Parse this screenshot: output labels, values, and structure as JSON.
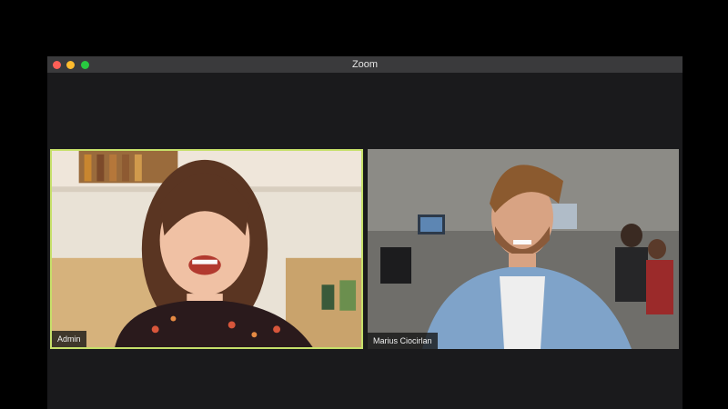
{
  "window": {
    "title": "Zoom"
  },
  "participants": [
    {
      "name": "Admin",
      "active_speaker": true
    },
    {
      "name": "Marius Ciocirlan",
      "active_speaker": false
    }
  ],
  "colors": {
    "active_speaker_border": "#c6e06a",
    "window_bg": "#1a1a1c",
    "titlebar_bg": "#3a3a3c",
    "close": "#ff5f57",
    "minimize": "#febc2e",
    "maximize": "#28c840"
  }
}
